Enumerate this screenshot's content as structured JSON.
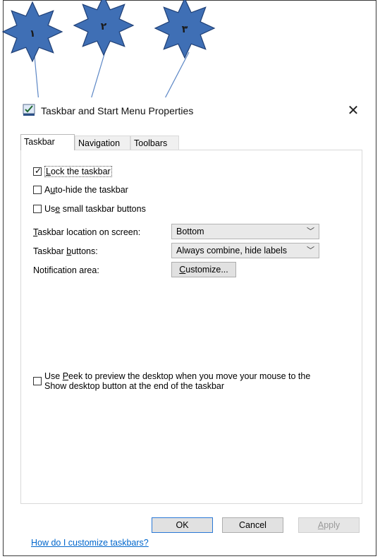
{
  "callouts": [
    {
      "label": "١",
      "target": "Taskbar"
    },
    {
      "label": "٢",
      "target": "Navigation"
    },
    {
      "label": "٣",
      "target": "Toolbars"
    }
  ],
  "callout_color": "#3f6fb5",
  "window": {
    "title": "Taskbar and Start Menu Properties",
    "close_icon": "close-icon"
  },
  "tabs": [
    {
      "label": "Taskbar",
      "active": true
    },
    {
      "label": "Navigation",
      "active": false
    },
    {
      "label": "Toolbars",
      "active": false
    }
  ],
  "checkboxes": {
    "lock": {
      "pre": "",
      "key": "L",
      "post": "ock the taskbar",
      "checked": true
    },
    "autohide": {
      "pre": "A",
      "key": "u",
      "post": "to-hide the taskbar",
      "checked": false
    },
    "small": {
      "pre": "Us",
      "key": "e",
      "post": " small taskbar buttons",
      "checked": false
    }
  },
  "location": {
    "label_key": "T",
    "label_rest": "askbar location on screen:",
    "value": "Bottom"
  },
  "buttons_setting": {
    "label_pre": "Taskbar ",
    "label_key": "b",
    "label_rest": "uttons:",
    "value": "Always combine, hide labels"
  },
  "notification": {
    "label": "Notification area:",
    "button_key": "C",
    "button_rest": "ustomize..."
  },
  "peek": {
    "pre": "Use ",
    "key": "P",
    "line1_rest": "eek to preview the desktop when you move your mouse to the",
    "line2": "Show desktop button at the end of the taskbar",
    "checked": false
  },
  "help_link": "How do I customize taskbars?",
  "footer": {
    "ok": "OK",
    "cancel": "Cancel",
    "apply_key": "A",
    "apply_rest": "pply"
  }
}
